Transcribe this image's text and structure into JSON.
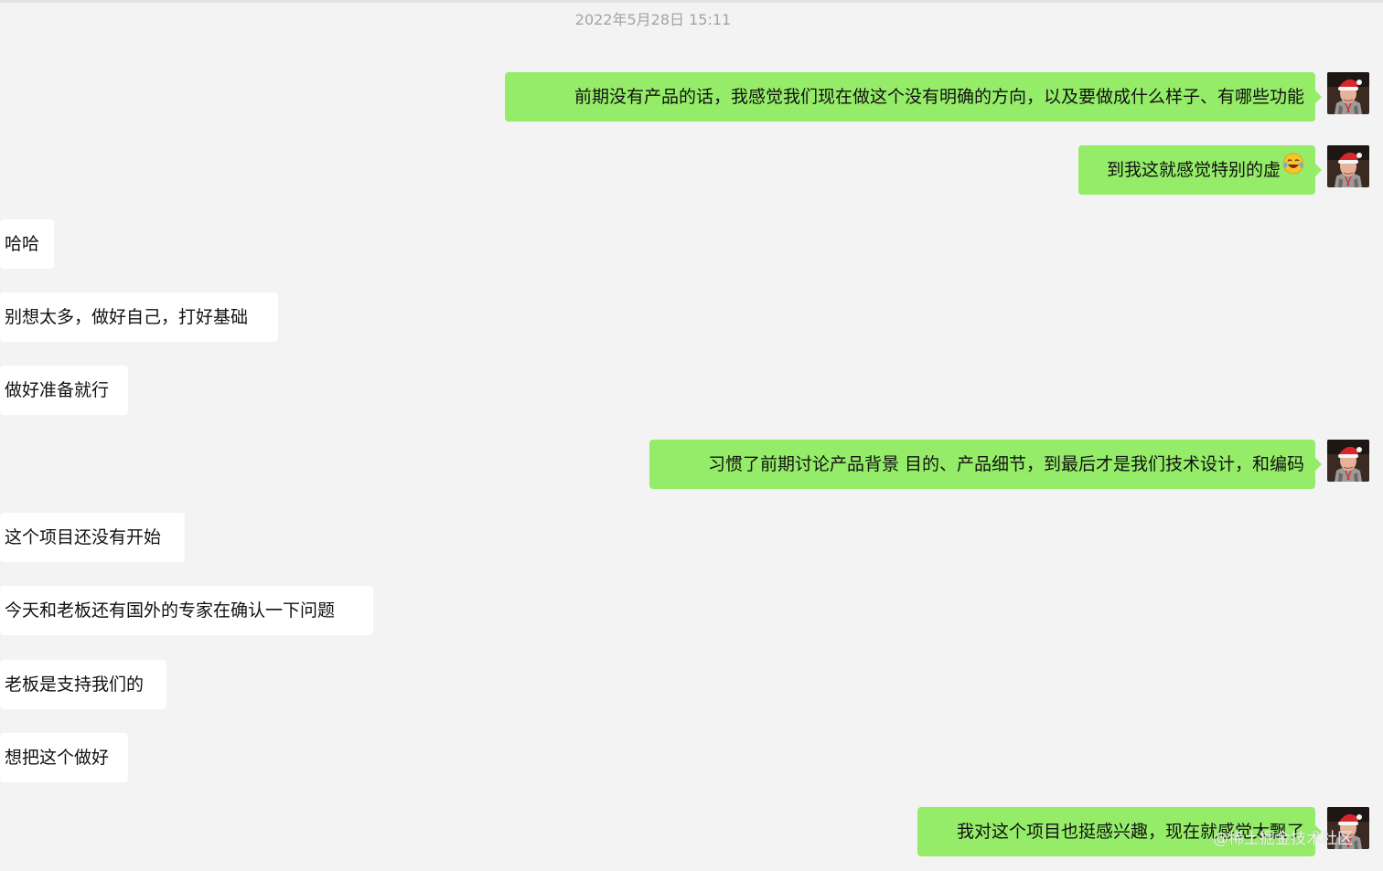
{
  "timestamp": "2022年5月28日 15:11",
  "messages": [
    {
      "side": "out",
      "text": "前期没有产品的话，我感觉我们现在做这个没有明确的方向，以及要做成什么样子、有哪些功能"
    },
    {
      "side": "out",
      "text": "到我这就感觉特别的虚",
      "emoji": "laughing-crying-emoji"
    },
    {
      "side": "in",
      "text": "哈哈"
    },
    {
      "side": "in",
      "text": "别想太多，做好自己，打好基础"
    },
    {
      "side": "in",
      "text": "做好准备就行"
    },
    {
      "side": "out",
      "text": "习惯了前期讨论产品背景 目的、产品细节，到最后才是我们技术设计，和编码"
    },
    {
      "side": "in",
      "text": "这个项目还没有开始"
    },
    {
      "side": "in",
      "text": "今天和老板还有国外的专家在确认一下问题"
    },
    {
      "side": "in",
      "text": "老板是支持我们的"
    },
    {
      "side": "in",
      "text": "想把这个做好"
    },
    {
      "side": "out",
      "text": "我对这个项目也挺感兴趣，现在就感觉太飘了"
    }
  ],
  "watermark": "@稀土掘金技术社区",
  "colors": {
    "background": "#f3f3f3",
    "outgoing_bubble": "#95ec69",
    "incoming_bubble": "#ffffff",
    "timestamp": "#a3a3a3"
  }
}
